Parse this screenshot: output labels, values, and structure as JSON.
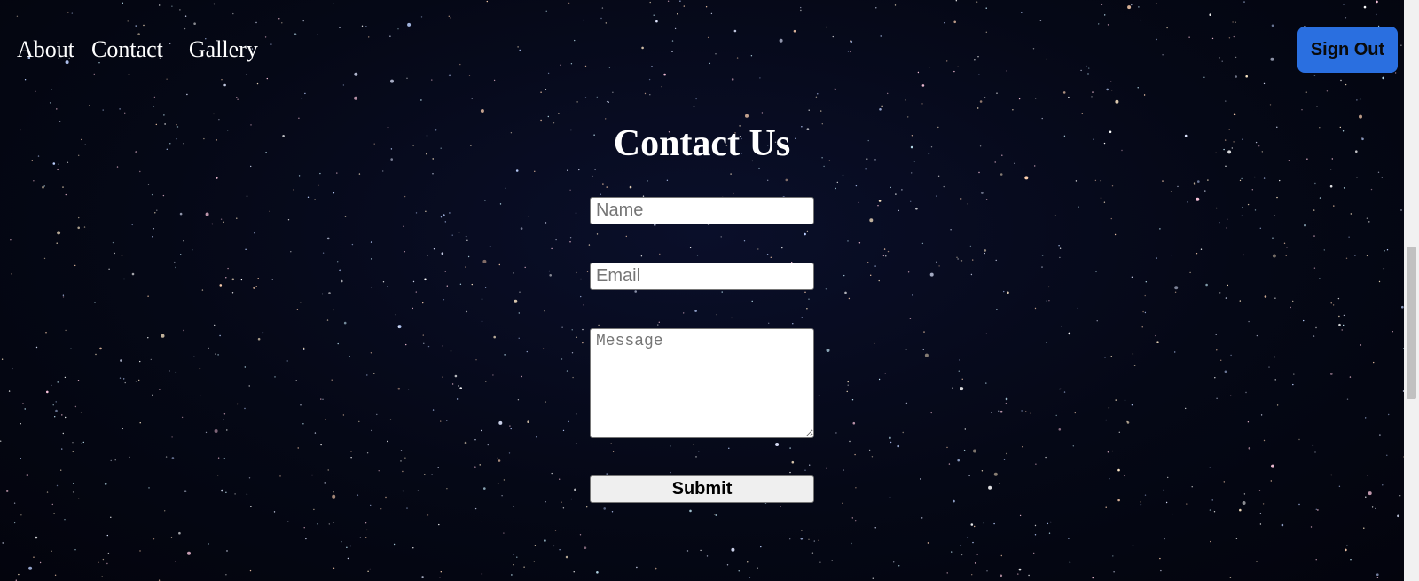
{
  "nav": {
    "items": [
      {
        "label": "About"
      },
      {
        "label": "Contact"
      },
      {
        "label": "Gallery"
      }
    ],
    "sign_out_label": "Sign Out"
  },
  "main": {
    "title": "Contact Us",
    "form": {
      "name_placeholder": "Name",
      "email_placeholder": "Email",
      "message_placeholder": "Message",
      "name_value": "",
      "email_value": "",
      "message_value": "",
      "submit_label": "Submit"
    }
  },
  "colors": {
    "background": "#050714",
    "sign_out_button": "#2a6fe0",
    "text": "#ffffff",
    "submit_button": "#efefef"
  }
}
